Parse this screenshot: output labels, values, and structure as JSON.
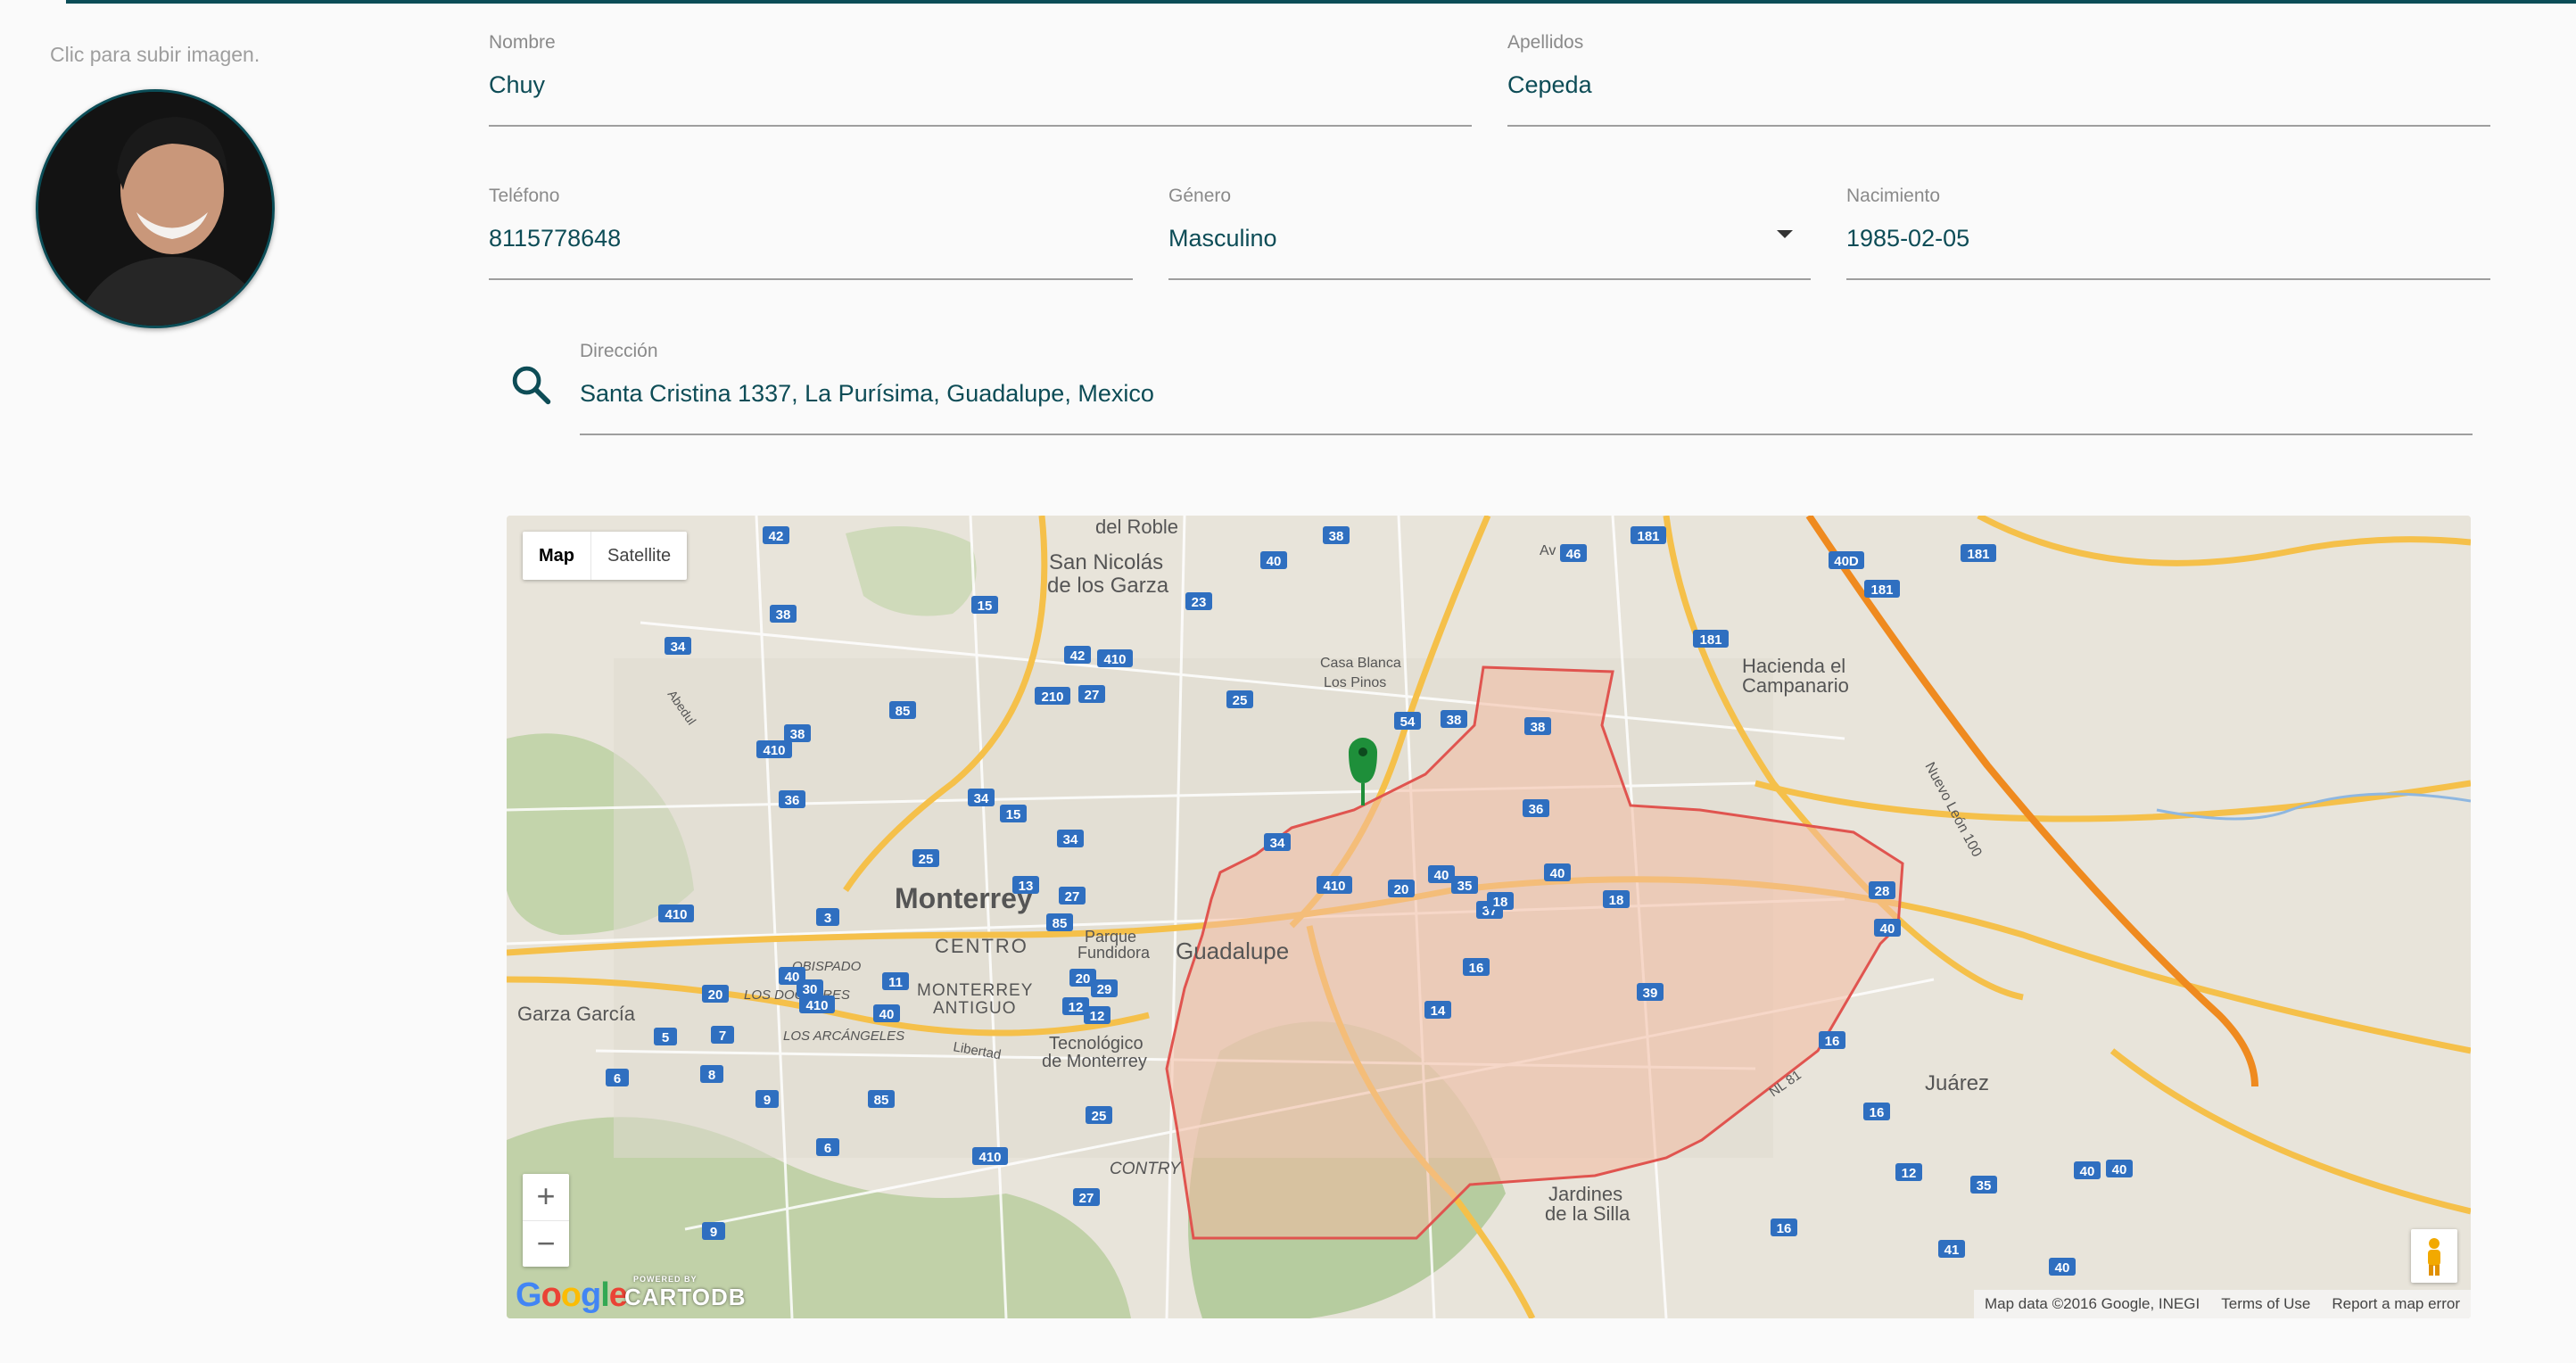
{
  "upload_hint": "Clic para subir imagen.",
  "form": {
    "nombre": {
      "label": "Nombre",
      "value": "Chuy"
    },
    "apellidos": {
      "label": "Apellidos",
      "value": "Cepeda"
    },
    "telefono": {
      "label": "Teléfono",
      "value": "8115778648"
    },
    "genero": {
      "label": "Género",
      "value": "Masculino"
    },
    "nacimiento": {
      "label": "Nacimiento",
      "value": "1985-02-05"
    },
    "direccion": {
      "label": "Dirección",
      "value": "Santa Cristina 1337, La Purísima, Guadalupe, Mexico"
    }
  },
  "map": {
    "type_buttons": [
      "Map",
      "Satellite"
    ],
    "zoom_in": "+",
    "zoom_out": "−",
    "footer": [
      "Map data ©2016 Google, INEGI",
      "Terms of Use",
      "Report a map error"
    ],
    "logo_google": "Google",
    "logo_cartodb": "CARTODB",
    "logo_cartodb_small": "POWERED BY",
    "places": {
      "monterrey": "Monterrey",
      "centro": "CENTRO",
      "guadalupe": "Guadalupe",
      "san_nicolas_1": "San Nicolás",
      "san_nicolas_2": "de los Garza",
      "del_roble": "del Roble",
      "garza_garcia": "Garza García",
      "juarez": "Juárez",
      "hacienda_1": "Hacienda el",
      "hacienda_2": "Campanario",
      "jardines_1": "Jardines",
      "jardines_2": "de la Silla",
      "tec_1": "Tecnológico",
      "tec_2": "de Monterrey",
      "mty_antiguo_1": "MONTERREY",
      "mty_antiguo_2": "ANTIGUO",
      "parque_1": "Parque",
      "parque_2": "Fundidora",
      "obispado": "OBISPADO",
      "los_doctores": "LOS DOCTORES",
      "los_arcangeles": "LOS ARCÁNGELES",
      "contry": "CONTRY",
      "casa_blanca": "Casa Blanca",
      "los_pinos": "Los Pinos",
      "av_e": "Av E",
      "abedul": "Abedul",
      "libertad": "Libertad",
      "nuevo_leon": "Nuevo León 100",
      "nl81": "NL 81"
    },
    "shields": [
      "42",
      "38",
      "34",
      "15",
      "40",
      "23",
      "42",
      "410",
      "210",
      "27",
      "25",
      "85",
      "38",
      "410",
      "36",
      "34",
      "15",
      "34",
      "25",
      "13",
      "85",
      "410",
      "3",
      "27",
      "40",
      "30",
      "20",
      "410",
      "11",
      "40",
      "5",
      "7",
      "8",
      "6",
      "9",
      "6",
      "410",
      "85",
      "25",
      "12",
      "20",
      "29",
      "12",
      "27",
      "9",
      "38",
      "54",
      "38",
      "36",
      "34",
      "410",
      "20",
      "40",
      "35",
      "37",
      "18",
      "40",
      "18",
      "16",
      "14",
      "39",
      "16",
      "16",
      "12",
      "16",
      "35",
      "41",
      "40",
      "40",
      "181",
      "181",
      "40D",
      "181",
      "181",
      "46",
      "28",
      "40",
      "40",
      "38"
    ],
    "colors": {
      "polygon_fill": "#f3b9a0",
      "polygon_stroke": "#e0544f",
      "marker": "#1e8f3a",
      "highway": "#f5c04a",
      "toll": "#ef8a1f",
      "accent": "#0b4d57"
    }
  }
}
